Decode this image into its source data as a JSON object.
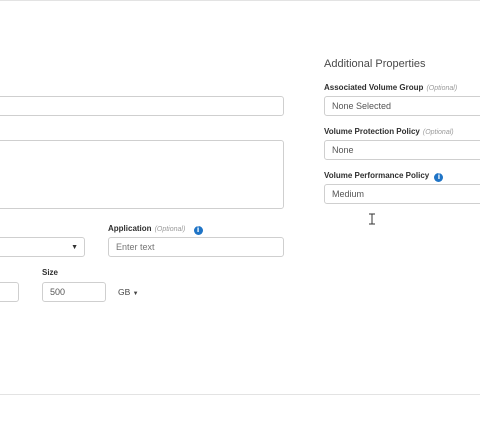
{
  "right_panel": {
    "heading": "Additional Properties",
    "volume_group": {
      "label": "Associated Volume Group",
      "optional": "(Optional)",
      "value": "None Selected"
    },
    "protection_policy": {
      "label": "Volume Protection Policy",
      "optional": "(Optional)",
      "value": "None"
    },
    "performance_policy": {
      "label": "Volume Performance Policy",
      "value": "Medium"
    }
  },
  "left_form": {
    "application": {
      "label": "Application",
      "optional": "(Optional)",
      "placeholder": "Enter text"
    },
    "size": {
      "label": "Size",
      "value": "500",
      "unit": "GB"
    }
  },
  "icons": {
    "info": "info-icon",
    "dropdown": "caret-down-icon",
    "cursor": "text-cursor-icon"
  },
  "colors": {
    "info_blue": "#1f74c6"
  }
}
